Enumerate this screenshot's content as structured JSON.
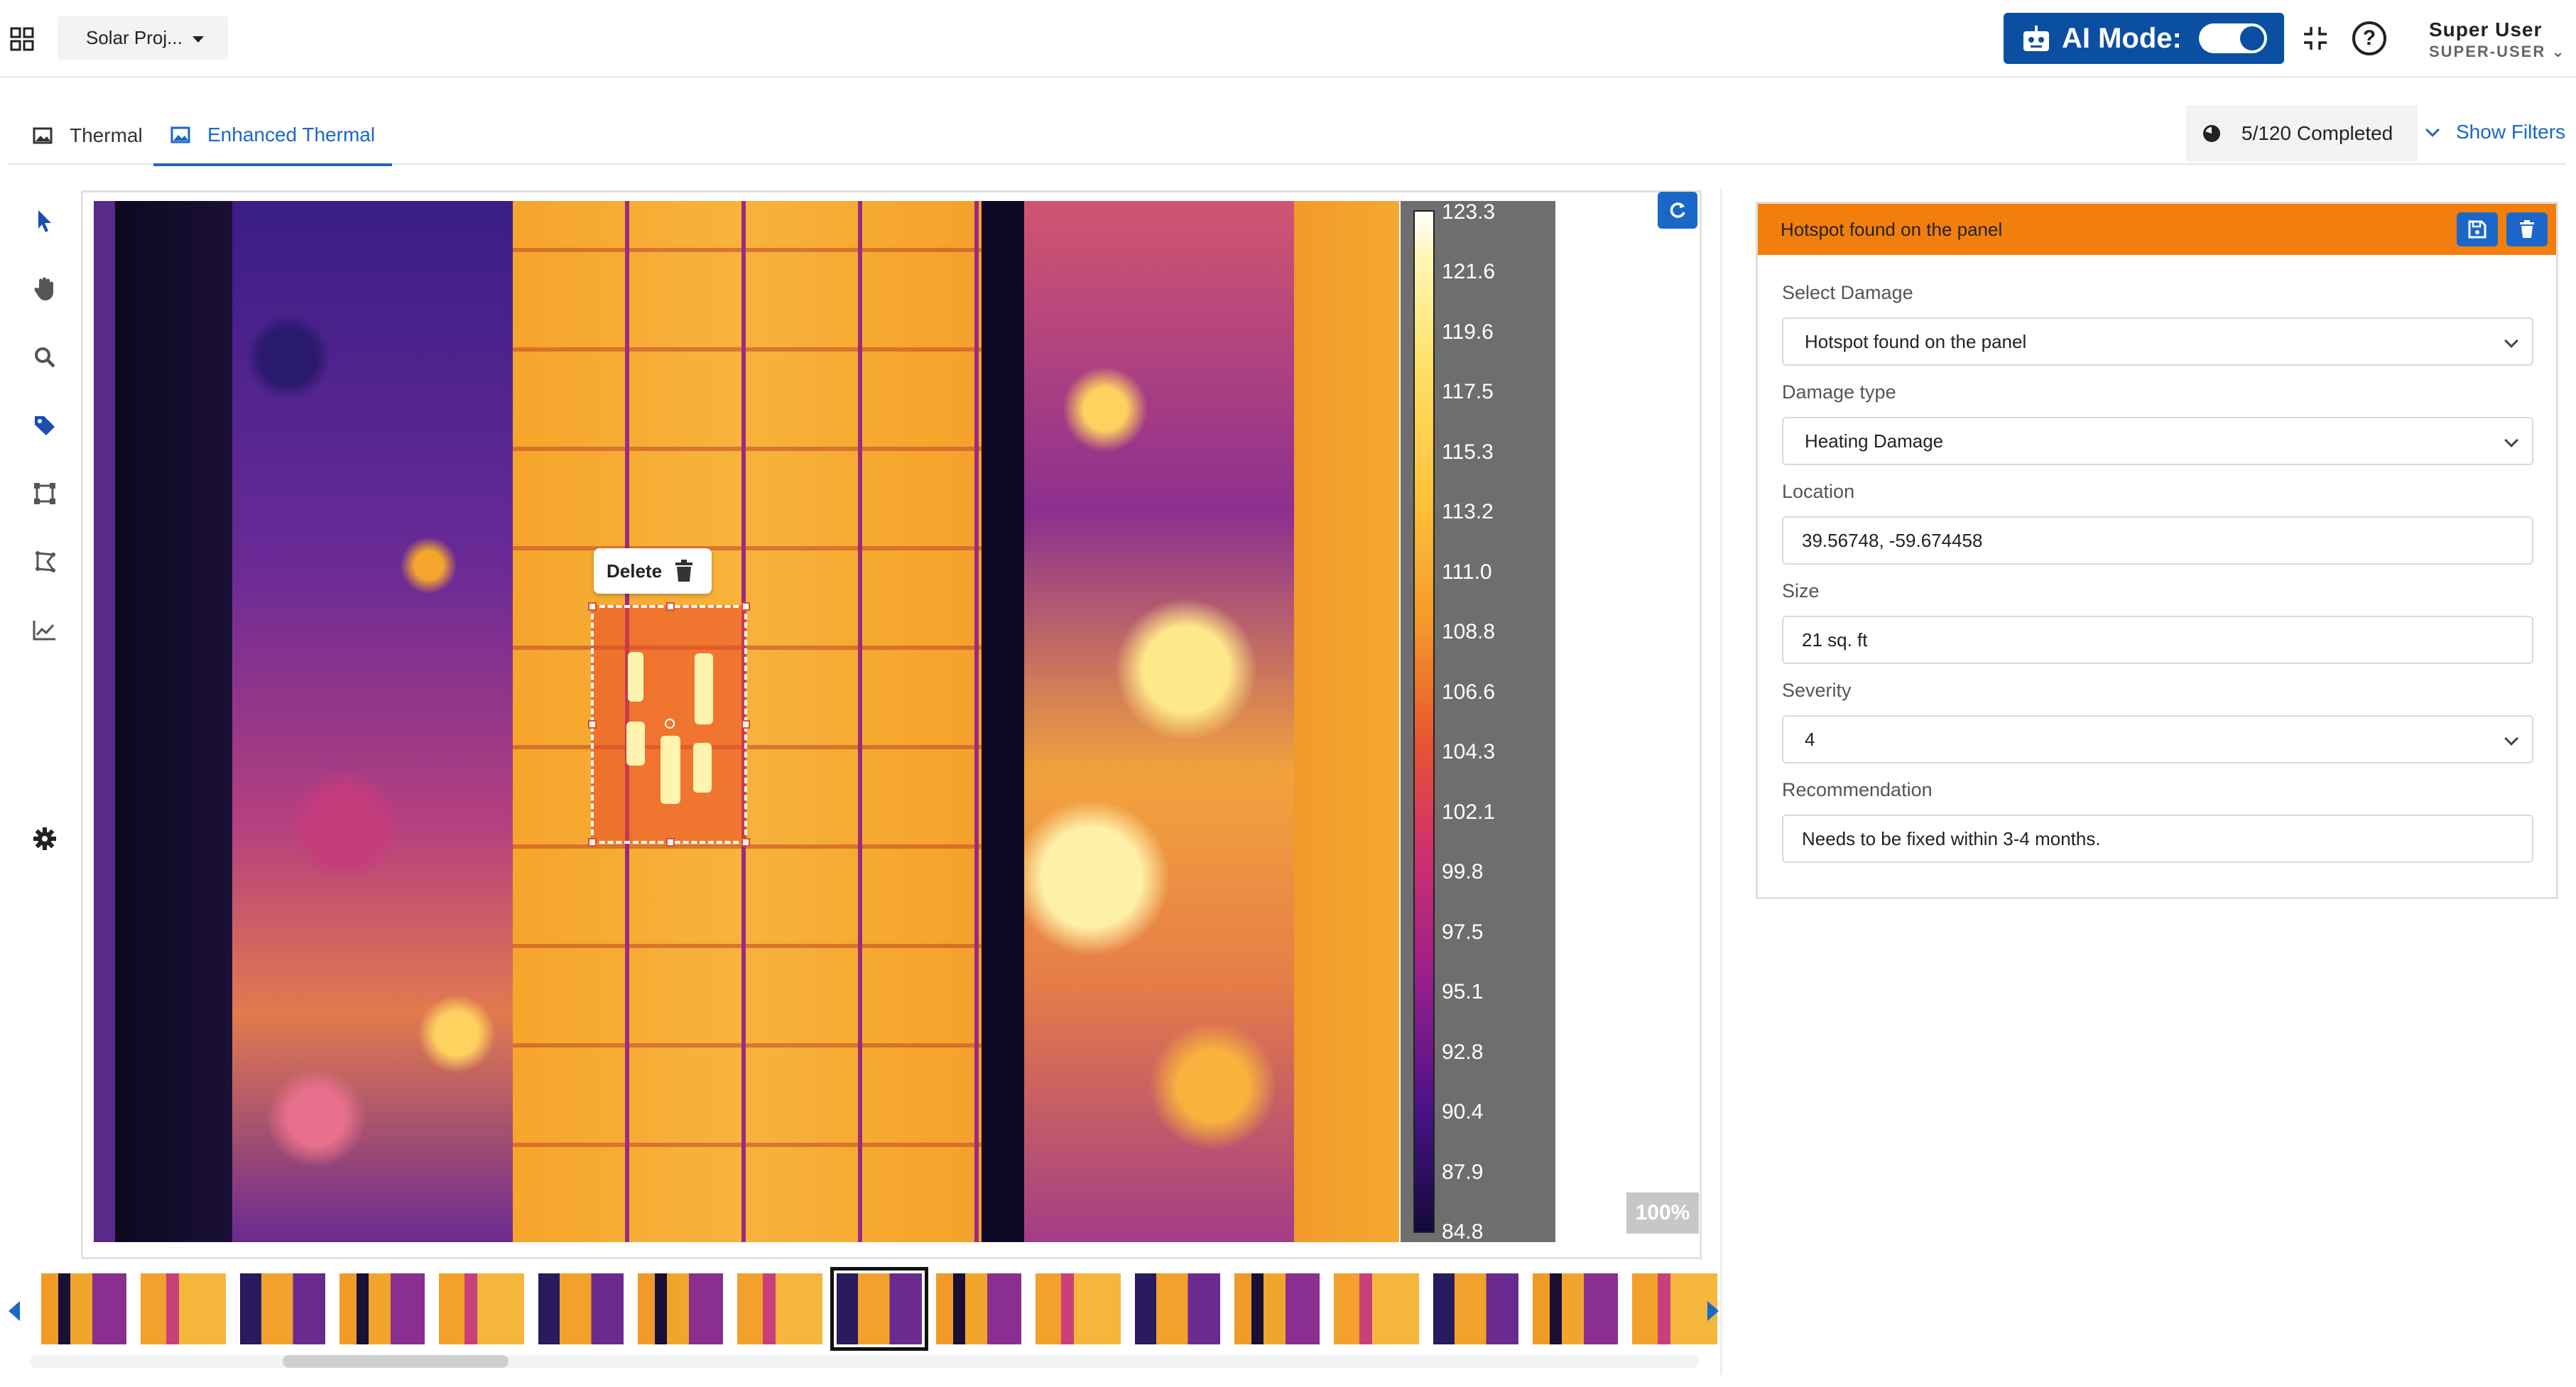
{
  "header": {
    "project": "Solar Proj...",
    "ai_mode_label": "AI Mode:",
    "help_symbol": "?",
    "user_name": "Super User",
    "user_role": "SUPER-USER"
  },
  "tabs": [
    {
      "label": "Thermal",
      "active": false
    },
    {
      "label": "Enhanced Thermal",
      "active": true
    }
  ],
  "progress": {
    "label": "5/120 Completed",
    "completed": 5,
    "total": 120
  },
  "filters_label": "Show Filters",
  "toolbar": [
    "pointer-icon",
    "hand-icon",
    "zoom-icon",
    "tag-icon",
    "bounding-box-icon",
    "polygon-icon",
    "chart-icon",
    "gear-icon"
  ],
  "viewer": {
    "zoom": "100%",
    "delete_label": "Delete",
    "colorbar_labels": [
      "123.3",
      "121.6",
      "119.6",
      "117.5",
      "115.3",
      "113.2",
      "111.0",
      "108.8",
      "106.6",
      "104.3",
      "102.1",
      "99.8",
      "97.5",
      "95.1",
      "92.8",
      "90.4",
      "87.9",
      "84.8"
    ],
    "thumbnail_count": 17,
    "selected_thumbnail": 8
  },
  "panel": {
    "title": "Hotspot found on the panel",
    "header_color": "#f27f0c",
    "fields": {
      "select_damage": {
        "label": "Select Damage",
        "value": "Hotspot found on the panel"
      },
      "damage_type": {
        "label": "Damage type",
        "value": "Heating Damage"
      },
      "location": {
        "label": "Location",
        "value": "39.56748, -59.674458"
      },
      "size": {
        "label": "Size",
        "value": "21 sq. ft"
      },
      "severity": {
        "label": "Severity",
        "value": "4"
      },
      "recommendation": {
        "label": "Recommendation",
        "value": "Needs to be fixed within 3-4 months."
      }
    }
  },
  "colors": {
    "accent": "#1a67c9",
    "brand": "#0b4fa2",
    "warning": "#f27f0c"
  }
}
